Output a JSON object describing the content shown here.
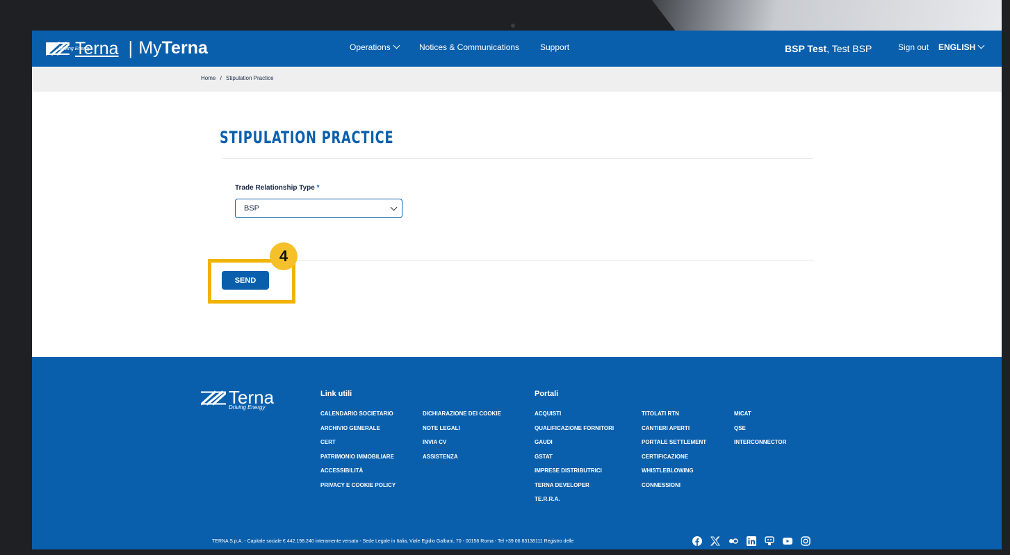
{
  "brand": {
    "name": "Terna",
    "tagline": "Driving Energy",
    "portal_prefix": "My",
    "portal_name": "Terna",
    "separator": "|"
  },
  "nav": {
    "items": [
      {
        "label": "Operations",
        "has_dropdown": true
      },
      {
        "label": "Notices & Communications"
      },
      {
        "label": "Support"
      }
    ],
    "user_name": "BSP Test",
    "user_sub": ", Test BSP",
    "signout": "Sign out",
    "language": "ENGLISH"
  },
  "breadcrumb": {
    "items": [
      "Home",
      "/",
      "Stipulation Practice"
    ]
  },
  "page": {
    "title": "STIPULATION PRACTICE",
    "field_label": "Trade Relationship Type",
    "required_mark": "*",
    "select_value": "BSP",
    "send_label": "SEND",
    "step_badge": "4"
  },
  "footer": {
    "logo": "Terna",
    "logo_tagline": "Driving Energy",
    "link_utili_heading": "Link utili",
    "link_utili_col1": [
      "CALENDARIO SOCIETARIO",
      "ARCHIVIO GENERALE",
      "CERT",
      "PATRIMONIO IMMOBILIARE",
      "ACCESSIBILITÀ",
      "PRIVACY E COOKIE POLICY"
    ],
    "link_utili_col2": [
      "DICHIARAZIONE DEI COOKIE",
      "NOTE LEGALI",
      "INVIA CV",
      "ASSISTENZA"
    ],
    "portali_heading": "Portali",
    "portali_col1": [
      "ACQUISTI",
      "QUALIFICAZIONE FORNITORI",
      "GAUDI",
      "GSTAT",
      "IMPRESE DISTRIBUTRICI",
      "TERNA DEVELOPER",
      "TE.R.R.A."
    ],
    "portali_col2": [
      "TITOLATI RTN",
      "CANTIERI APERTI",
      "PORTALE SETTLEMENT",
      "CERTIFICAZIONE",
      "WHISTLEBLOWING",
      "CONNESSIONI"
    ],
    "portali_col3": [
      "MICAT",
      "QSE",
      "INTERCONNECTOR"
    ],
    "legal": "TERNA S.p.A. - Capitale sociale € 442.198.240 interamente versato - Sede Legale in Italia, Viale Egidio Galbani, 70 - 00156 Roma - Tel +39 06 83138111 Registro delle",
    "social_icons": [
      "facebook-icon",
      "x-icon",
      "flickr-icon",
      "linkedin-icon",
      "podcast-icon",
      "youtube-icon",
      "instagram-icon"
    ]
  },
  "colors": {
    "primary": "#0a5fac",
    "highlight": "#f0b400",
    "badge": "#f6c02a",
    "breadcrumb_bg": "#efefef"
  }
}
